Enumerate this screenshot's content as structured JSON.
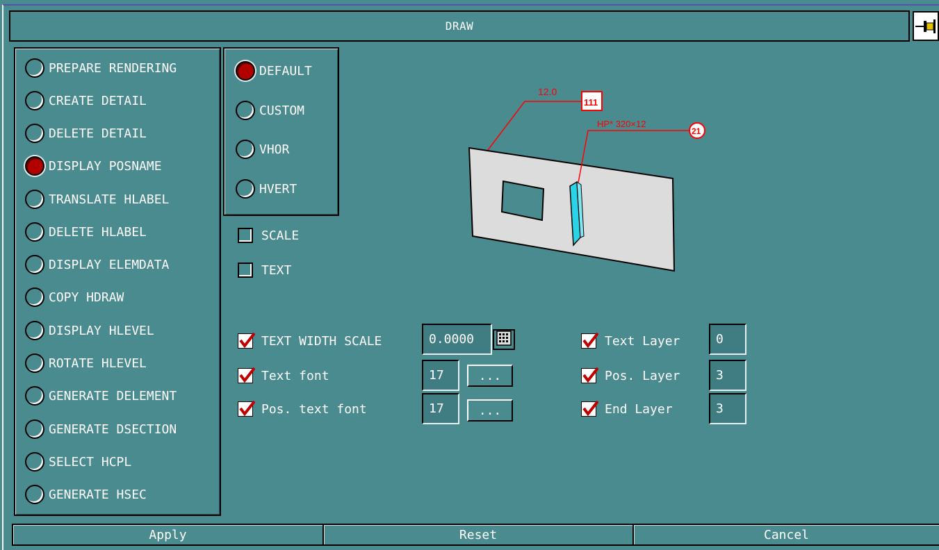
{
  "window": {
    "title": "DRAW"
  },
  "functions": [
    {
      "label": "PREPARE RENDERING",
      "selected": false
    },
    {
      "label": "CREATE DETAIL",
      "selected": false
    },
    {
      "label": "DELETE DETAIL",
      "selected": false
    },
    {
      "label": "DISPLAY POSNAME",
      "selected": true
    },
    {
      "label": "TRANSLATE HLABEL",
      "selected": false
    },
    {
      "label": "DELETE HLABEL",
      "selected": false
    },
    {
      "label": "DISPLAY ELEMDATA",
      "selected": false
    },
    {
      "label": "COPY HDRAW",
      "selected": false
    },
    {
      "label": "DISPLAY HLEVEL",
      "selected": false
    },
    {
      "label": "ROTATE HLEVEL",
      "selected": false
    },
    {
      "label": "GENERATE DELEMENT",
      "selected": false
    },
    {
      "label": "GENERATE DSECTION",
      "selected": false
    },
    {
      "label": "SELECT HCPL",
      "selected": false
    },
    {
      "label": "GENERATE HSEC",
      "selected": false
    }
  ],
  "modes": [
    {
      "label": "DEFAULT",
      "selected": true
    },
    {
      "label": "CUSTOM",
      "selected": false
    },
    {
      "label": "VHOR",
      "selected": false
    },
    {
      "label": "HVERT",
      "selected": false
    }
  ],
  "options": [
    {
      "label": "SCALE",
      "checked": false
    },
    {
      "label": "TEXT",
      "checked": false
    }
  ],
  "text_settings": {
    "width_scale": {
      "label": "TEXT WIDTH SCALE",
      "checked": true,
      "value": "0.0000"
    },
    "text_font": {
      "label": "Text font",
      "checked": true,
      "value": "17",
      "browse": "..."
    },
    "pos_text_font": {
      "label": "Pos. text font",
      "checked": true,
      "value": "17",
      "browse": "..."
    }
  },
  "layers": {
    "text_layer": {
      "label": "Text Layer",
      "checked": true,
      "value": "0"
    },
    "pos_layer": {
      "label": "Pos. Layer",
      "checked": true,
      "value": "3"
    },
    "end_layer": {
      "label": "End Layer",
      "checked": true,
      "value": "3"
    }
  },
  "preview": {
    "dimension_text": "12.0",
    "tag_111": "111",
    "profile_text": "HP* 320×12",
    "tag_21": "21",
    "accent_red": "#ff0000",
    "plate_color": "#dcdcdc",
    "profile_color": "#2ad4e6"
  },
  "buttons": {
    "apply": "Apply",
    "reset": "Reset",
    "cancel": "Cancel"
  },
  "colors": {
    "background": "#4a8b90",
    "selected_radio": "#b00000"
  }
}
